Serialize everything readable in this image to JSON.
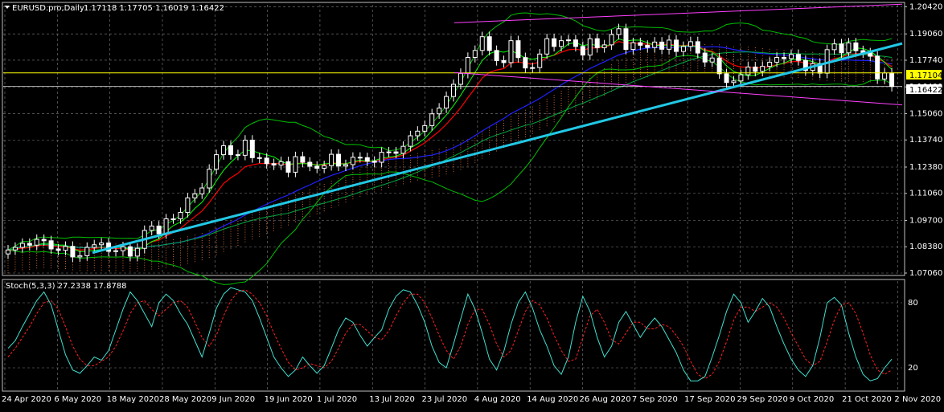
{
  "main_header": {
    "symbol_label": "EURUSD.pro,Daily",
    "ohlc_text": "1.17118 1.17705 1.16019 1.16422"
  },
  "sub_header": {
    "label": "Stoch(5,3,3) 27.2338 17.8788"
  },
  "price_tags": {
    "current": "1.17104",
    "bid": "1.16422"
  },
  "colors": {
    "background": "#000000",
    "grid": "#808080",
    "candle_up": "#ffffff",
    "candle_down": "#ffffff",
    "trend_line": "#22c8e6",
    "channel": "#ff40ff",
    "bollinger": "#00c000",
    "ma_red": "#ff0000",
    "ma_blue": "#2020ff",
    "ma_green": "#00ff00",
    "ichimoku_cloud": "#ff8040",
    "stoch_main": "#40e0d0",
    "stoch_signal": "#ff2020",
    "horizontal_line": "#ffff00"
  },
  "chart_data": [
    {
      "type": "candlestick",
      "title": "EURUSD.pro,Daily",
      "y_tick_labels": [
        "1.20420",
        "1.19060",
        "1.17740",
        "1.16400",
        "1.15060",
        "1.13740",
        "1.12380",
        "1.11060",
        "1.09700",
        "1.08380",
        "1.07060"
      ],
      "ylim": [
        1.0706,
        1.2052
      ],
      "x_tick_labels": [
        "24 Apr 2020",
        "6 May 2020",
        "18 May 2020",
        "28 May 2020",
        "9 Jun 2020",
        "19 Jun 2020",
        "1 Jul 2020",
        "13 Jul 2020",
        "23 Jul 2020",
        "4 Aug 2020",
        "14 Aug 2020",
        "26 Aug 2020",
        "7 Sep 2020",
        "17 Sep 2020",
        "29 Sep 2020",
        "9 Oct 2020",
        "21 Oct 2020",
        "2 Nov 2020"
      ],
      "close": [
        1.0822,
        1.0835,
        1.0855,
        1.0846,
        1.0875,
        1.0868,
        1.0827,
        1.082,
        1.084,
        1.0787,
        1.0793,
        1.0835,
        1.0848,
        1.0857,
        1.0815,
        1.0818,
        1.0838,
        1.0791,
        1.083,
        1.092,
        1.0942,
        1.0903,
        1.0978,
        1.0978,
        1.101,
        1.1083,
        1.1103,
        1.1133,
        1.1227,
        1.13,
        1.1345,
        1.13,
        1.1297,
        1.1373,
        1.1285,
        1.1283,
        1.1255,
        1.1248,
        1.1265,
        1.1212,
        1.129,
        1.1262,
        1.1242,
        1.1232,
        1.1245,
        1.1302,
        1.1243,
        1.125,
        1.1287,
        1.1285,
        1.1267,
        1.1262,
        1.1312,
        1.1314,
        1.1307,
        1.1342,
        1.1395,
        1.1418,
        1.1446,
        1.1505,
        1.1534,
        1.1592,
        1.1653,
        1.1708,
        1.1788,
        1.1823,
        1.1892,
        1.1823,
        1.1772,
        1.1762,
        1.1872,
        1.1787,
        1.1735,
        1.1737,
        1.1805,
        1.1882,
        1.1843,
        1.1872,
        1.1876,
        1.1843,
        1.18,
        1.1882,
        1.1837,
        1.1851,
        1.1903,
        1.1932,
        1.1828,
        1.1862,
        1.1849,
        1.1838,
        1.1865,
        1.1829,
        1.1875,
        1.1818,
        1.1843,
        1.1867,
        1.181,
        1.1765,
        1.1785,
        1.1706,
        1.1662,
        1.167,
        1.1701,
        1.174,
        1.1718,
        1.1743,
        1.1764,
        1.1788,
        1.1782,
        1.1803,
        1.1773,
        1.1723,
        1.1757,
        1.1709,
        1.1827,
        1.1856,
        1.1811,
        1.1861,
        1.1822,
        1.1811,
        1.1794,
        1.168,
        1.171,
        1.1642
      ],
      "stoch_levels": [
        80,
        20
      ],
      "stoch_main": [
        38,
        45,
        58,
        70,
        82,
        90,
        78,
        55,
        32,
        18,
        15,
        22,
        30,
        27,
        36,
        55,
        74,
        90,
        82,
        70,
        58,
        80,
        88,
        82,
        70,
        60,
        45,
        30,
        52,
        75,
        88,
        94,
        92,
        90,
        82,
        66,
        48,
        30,
        20,
        12,
        18,
        30,
        22,
        15,
        22,
        38,
        55,
        66,
        62,
        50,
        40,
        48,
        55,
        74,
        86,
        92,
        90,
        78,
        62,
        40,
        25,
        20,
        42,
        65,
        88,
        74,
        52,
        28,
        18,
        35,
        60,
        80,
        90,
        75,
        55,
        40,
        22,
        14,
        30,
        62,
        86,
        72,
        48,
        30,
        40,
        62,
        72,
        60,
        48,
        58,
        66,
        58,
        46,
        34,
        18,
        8,
        8,
        12,
        30,
        50,
        72,
        88,
        80,
        62,
        72,
        84,
        76,
        58,
        42,
        28,
        18,
        12,
        22,
        48,
        80,
        85,
        78,
        52,
        30,
        14,
        8,
        10,
        20,
        28
      ],
      "stoch_signal": [
        30,
        38,
        48,
        58,
        70,
        80,
        82,
        74,
        58,
        40,
        28,
        22,
        22,
        26,
        30,
        40,
        54,
        70,
        80,
        82,
        74,
        68,
        74,
        80,
        82,
        76,
        62,
        48,
        40,
        50,
        68,
        82,
        90,
        92,
        88,
        80,
        68,
        52,
        38,
        25,
        18,
        20,
        24,
        22,
        20,
        26,
        38,
        52,
        60,
        60,
        54,
        48,
        46,
        54,
        68,
        80,
        88,
        88,
        80,
        66,
        50,
        36,
        28,
        40,
        60,
        74,
        74,
        60,
        42,
        30,
        36,
        54,
        72,
        82,
        78,
        66,
        50,
        36,
        26,
        28,
        48,
        68,
        74,
        62,
        46,
        42,
        52,
        62,
        62,
        56,
        56,
        60,
        58,
        50,
        40,
        26,
        14,
        10,
        14,
        26,
        44,
        64,
        76,
        76,
        72,
        76,
        80,
        76,
        66,
        52,
        40,
        28,
        22,
        26,
        44,
        64,
        78,
        80,
        70,
        52,
        32,
        18,
        14,
        18
      ]
    }
  ]
}
